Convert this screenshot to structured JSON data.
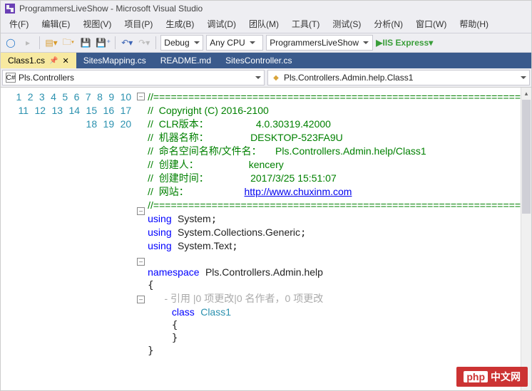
{
  "window": {
    "title": "ProgrammersLiveShow - Microsoft Visual Studio"
  },
  "menu": [
    {
      "label": "件(F)"
    },
    {
      "label": "编辑(E)"
    },
    {
      "label": "视图(V)"
    },
    {
      "label": "项目(P)"
    },
    {
      "label": "生成(B)"
    },
    {
      "label": "调试(D)"
    },
    {
      "label": "团队(M)"
    },
    {
      "label": "工具(T)"
    },
    {
      "label": "测试(S)"
    },
    {
      "label": "分析(N)"
    },
    {
      "label": "窗口(W)"
    },
    {
      "label": "帮助(H)"
    }
  ],
  "toolbar": {
    "config": "Debug",
    "platform": "Any CPU",
    "startup": "ProgrammersLiveShow",
    "run": "IIS Express"
  },
  "tabs": [
    {
      "label": "Class1.cs",
      "active": true
    },
    {
      "label": "SitesMapping.cs"
    },
    {
      "label": "README.md"
    },
    {
      "label": "SitesController.cs"
    }
  ],
  "nav": {
    "namespace": "Pls.Controllers",
    "class": "Pls.Controllers.Admin.help.Class1"
  },
  "code": {
    "ln1": "1",
    "ln2": "2",
    "ln3": "3",
    "ln4": "4",
    "ln5": "5",
    "ln6": "6",
    "ln7": "7",
    "ln8": "8",
    "ln9": "9",
    "ln10": "10",
    "ln11": "11",
    "ln12": "12",
    "ln13": "13",
    "ln14": "14",
    "ln15": "15",
    "ln16": "16",
    "ln17": "17",
    "ln18": "18",
    "ln19": "19",
    "ln20": "20",
    "l1": "//===============================================================",
    "l2": " Copyright (C) 2016-2100",
    "l3a": " CLR版本：",
    "l3b": "4.0.30319.42000",
    "l4a": " 机器名称：",
    "l4b": "DESKTOP-523FA9U",
    "l5a": " 命名空间名称/文件名：",
    "l5b": "Pls.Controllers.Admin.help/Class1",
    "l6a": " 创建人：",
    "l6b": "kencery",
    "l7a": " 创建时间：",
    "l7b": "2017/3/25 15:51:07",
    "l8a": " 网站：",
    "l8b": "http://www.chuxinm.com",
    "l9": "//===============================================================",
    "k_using": "using",
    "k_namespace": "namespace",
    "k_class": "class",
    "ns1": "System",
    "ns2": "System.Collections.Generic",
    "ns3": "System.Text",
    "ns_full": "Pls.Controllers.Admin.help",
    "codelens": "      - 引用 |0 项更改|0 名作者，0 项更改",
    "classname": "Class1"
  },
  "watermark": {
    "prefix": "php",
    "text": "中文网"
  }
}
